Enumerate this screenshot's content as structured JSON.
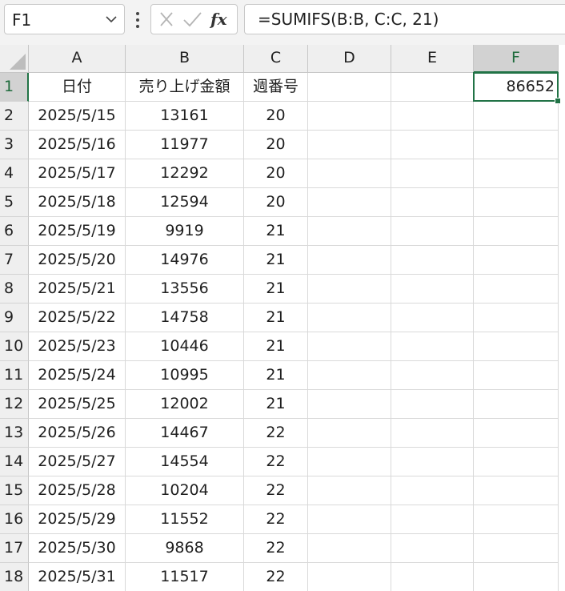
{
  "formula_bar": {
    "name_box": "F1",
    "formula": "=SUMIFS(B:B, C:C, 21)",
    "icons": {
      "name_box_dropdown": "chevron-down-icon",
      "more": "vertical-ellipsis-icon",
      "cancel": "cancel-x-icon",
      "enter": "check-icon",
      "insert_function": "fx-icon"
    },
    "fx_label": "fx"
  },
  "sheet": {
    "columns": [
      "A",
      "B",
      "C",
      "D",
      "E",
      "F"
    ],
    "selected_column": "F",
    "selected_row": "1",
    "accent_color": "#217346",
    "rows": [
      {
        "num": "1",
        "cells": [
          "日付",
          "売り上げ金額",
          "週番号",
          "",
          "",
          "86652"
        ]
      },
      {
        "num": "2",
        "cells": [
          "2025/5/15",
          "13161",
          "20",
          "",
          "",
          ""
        ]
      },
      {
        "num": "3",
        "cells": [
          "2025/5/16",
          "11977",
          "20",
          "",
          "",
          ""
        ]
      },
      {
        "num": "4",
        "cells": [
          "2025/5/17",
          "12292",
          "20",
          "",
          "",
          ""
        ]
      },
      {
        "num": "5",
        "cells": [
          "2025/5/18",
          "12594",
          "20",
          "",
          "",
          ""
        ]
      },
      {
        "num": "6",
        "cells": [
          "2025/5/19",
          "9919",
          "21",
          "",
          "",
          ""
        ]
      },
      {
        "num": "7",
        "cells": [
          "2025/5/20",
          "14976",
          "21",
          "",
          "",
          ""
        ]
      },
      {
        "num": "8",
        "cells": [
          "2025/5/21",
          "13556",
          "21",
          "",
          "",
          ""
        ]
      },
      {
        "num": "9",
        "cells": [
          "2025/5/22",
          "14758",
          "21",
          "",
          "",
          ""
        ]
      },
      {
        "num": "10",
        "cells": [
          "2025/5/23",
          "10446",
          "21",
          "",
          "",
          ""
        ]
      },
      {
        "num": "11",
        "cells": [
          "2025/5/24",
          "10995",
          "21",
          "",
          "",
          ""
        ]
      },
      {
        "num": "12",
        "cells": [
          "2025/5/25",
          "12002",
          "21",
          "",
          "",
          ""
        ]
      },
      {
        "num": "13",
        "cells": [
          "2025/5/26",
          "14467",
          "22",
          "",
          "",
          ""
        ]
      },
      {
        "num": "14",
        "cells": [
          "2025/5/27",
          "14554",
          "22",
          "",
          "",
          ""
        ]
      },
      {
        "num": "15",
        "cells": [
          "2025/5/28",
          "10204",
          "22",
          "",
          "",
          ""
        ]
      },
      {
        "num": "16",
        "cells": [
          "2025/5/29",
          "11552",
          "22",
          "",
          "",
          ""
        ]
      },
      {
        "num": "17",
        "cells": [
          "2025/5/30",
          "9868",
          "22",
          "",
          "",
          ""
        ]
      },
      {
        "num": "18",
        "cells": [
          "2025/5/31",
          "11517",
          "22",
          "",
          "",
          ""
        ]
      }
    ]
  }
}
